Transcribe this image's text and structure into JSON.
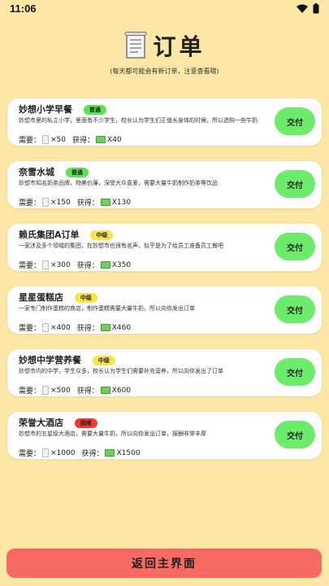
{
  "statusbar": {
    "time": "11:06"
  },
  "header": {
    "title": "订单",
    "subtitle": "(每天都可能会有新订单，注意查看哦)",
    "icon": "receipt-icon"
  },
  "orders": [
    {
      "name": "妙想小学早餐",
      "badge": "普通",
      "badge_color": "#5BE350",
      "desc": "妙想市里的私立小学，里面有不少学生，校长认为学生们正值长身体的时候，所以选购一些牛奶",
      "need_label": "需要：",
      "need_qty": "×50",
      "reward_label": "获得：",
      "reward_amt": "X40",
      "pay_label": "交付"
    },
    {
      "name": "奈雪水城",
      "badge": "普通",
      "badge_color": "#5BE350",
      "desc": "妙想市知名奶茶品牌，物美价廉，深受大众喜爱，需要大量牛奶制作奶茶等饮品",
      "need_label": "需要：",
      "need_qty": "×150",
      "reward_label": "获得：",
      "reward_amt": "X130",
      "pay_label": "交付"
    },
    {
      "name": "赖氏集团A订单",
      "badge": "中级",
      "badge_color": "#F7E34A",
      "desc": "一家涉及多个领域的集团，在妙想市也很有名声，似乎是为了给员工准备员工餐吧",
      "need_label": "需要：",
      "need_qty": "×300",
      "reward_label": "获得：",
      "reward_amt": "X350",
      "pay_label": "交付"
    },
    {
      "name": "星星蛋糕店",
      "badge": "中级",
      "badge_color": "#F7E34A",
      "desc": "一家专门制作蛋糕的商店，制作蛋糕需要大量牛奶，所以向你发出订单",
      "need_label": "需要：",
      "need_qty": "×400",
      "reward_label": "获得：",
      "reward_amt": "X460",
      "pay_label": "交付"
    },
    {
      "name": "妙想中学营养餐",
      "badge": "中级",
      "badge_color": "#F7E34A",
      "desc": "妙想市内的中学，学生众多，校长认为学生们需要补充营养，所以向你发出了订单",
      "need_label": "需要：",
      "need_qty": "×500",
      "reward_label": "获得：",
      "reward_amt": "X600",
      "pay_label": "交付"
    },
    {
      "name": "荣誉大酒店",
      "badge": "困难",
      "badge_color": "#F23A2E",
      "desc": "妙想市的五星级大酒店，需要大量牛奶，所以向你发出订单，报酬非常丰厚",
      "need_label": "需要：",
      "need_qty": "×1000",
      "reward_label": "获得：",
      "reward_amt": "X1500",
      "pay_label": "交付"
    }
  ],
  "back_button": {
    "label": "返回主界面"
  }
}
